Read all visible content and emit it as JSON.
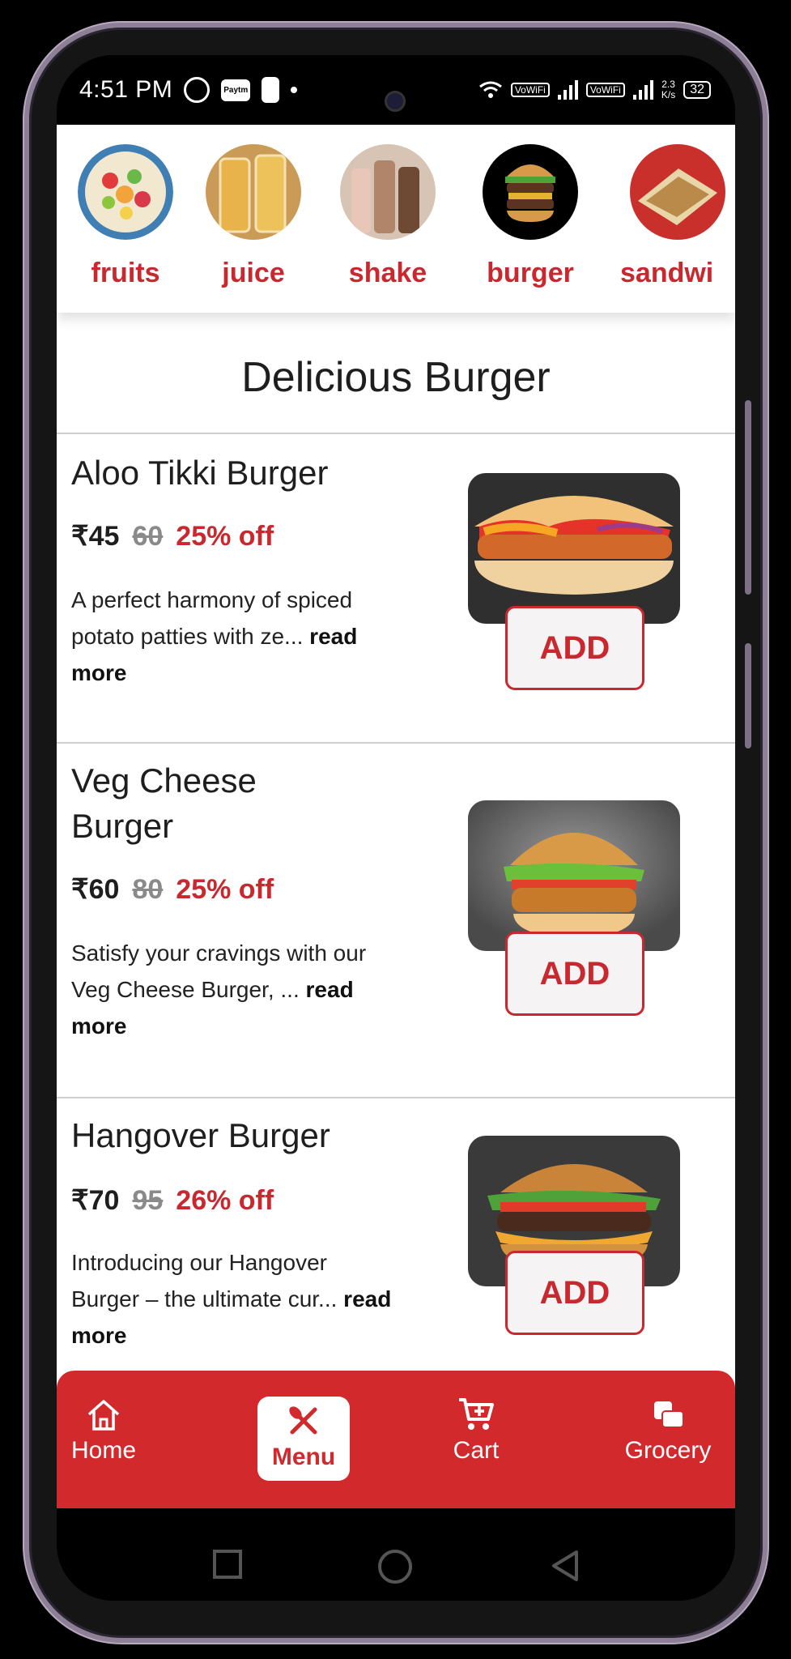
{
  "status_bar": {
    "time": "4:51 PM",
    "vowifi_1": "VoWiFi",
    "vowifi_2": "VoWiFi",
    "speed_value": "2.3",
    "speed_unit": "K/s",
    "battery": "32",
    "paytm": "Paytm"
  },
  "categories": [
    {
      "label": "fruits"
    },
    {
      "label": "juice"
    },
    {
      "label": "shake"
    },
    {
      "label": "burger"
    },
    {
      "label": "sandwi"
    }
  ],
  "section": {
    "title": "Delicious Burger"
  },
  "items": [
    {
      "title": "Aloo Tikki Burger",
      "price": "₹45",
      "original_price": "60",
      "discount": "25% off",
      "description": "A perfect harmony of spiced potato patties with ze...",
      "read_more": "read more",
      "add_label": "ADD"
    },
    {
      "title": "Veg Cheese Burger",
      "price": "₹60",
      "original_price": "80",
      "discount": "25% off",
      "description": "Satisfy your cravings with our Veg Cheese Burger, ...",
      "read_more": "read more",
      "add_label": "ADD"
    },
    {
      "title": "Hangover Burger",
      "price": "₹70",
      "original_price": "95",
      "discount": "26% off",
      "description": "Introducing our Hangover Burger – the ultimate cur...",
      "read_more": "read more",
      "add_label": "ADD"
    }
  ],
  "bottom_nav": {
    "home": "Home",
    "menu": "Menu",
    "cart": "Cart",
    "grocery": "Grocery"
  },
  "colors": {
    "brand_red": "#d2292d",
    "category_red": "#c8282e"
  }
}
